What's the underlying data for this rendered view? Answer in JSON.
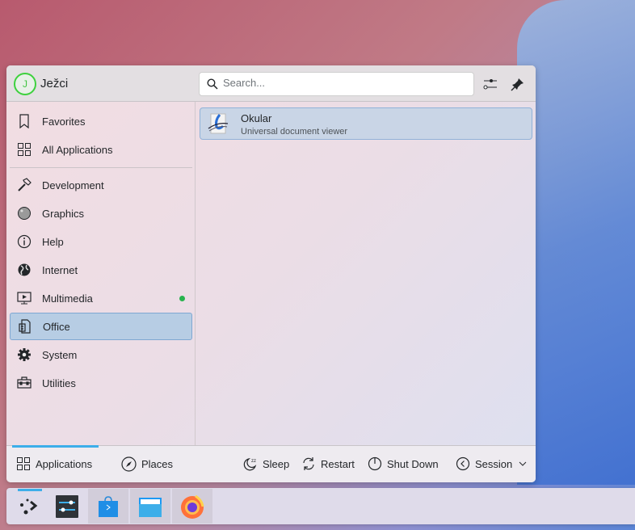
{
  "user": {
    "name": "Ježci",
    "initial": "J"
  },
  "search": {
    "placeholder": "Search..."
  },
  "header_buttons": [
    {
      "icon": "configure-icon"
    },
    {
      "icon": "pin-icon"
    }
  ],
  "sidebar": {
    "items": [
      {
        "label": "Favorites",
        "icon": "bookmark-icon"
      },
      {
        "label": "All Applications",
        "icon": "grid-icon"
      },
      {
        "label": "Development",
        "icon": "hammer-icon"
      },
      {
        "label": "Graphics",
        "icon": "graphics-icon"
      },
      {
        "label": "Help",
        "icon": "info-icon"
      },
      {
        "label": "Internet",
        "icon": "globe-icon"
      },
      {
        "label": "Multimedia",
        "icon": "monitor-play-icon",
        "badge": "new"
      },
      {
        "label": "Office",
        "icon": "office-icon",
        "active": true
      },
      {
        "label": "System",
        "icon": "gear-icon"
      },
      {
        "label": "Utilities",
        "icon": "toolbox-icon"
      }
    ]
  },
  "apps": [
    {
      "name": "Okular",
      "description": "Universal document viewer"
    }
  ],
  "footer": {
    "tabs": [
      {
        "label": "Applications",
        "active": true
      },
      {
        "label": "Places"
      }
    ],
    "actions": [
      {
        "label": "Sleep"
      },
      {
        "label": "Restart"
      },
      {
        "label": "Shut Down"
      },
      {
        "label": "Session"
      }
    ]
  },
  "colors": {
    "accent": "#3daee9",
    "badge": "#28b34e"
  }
}
